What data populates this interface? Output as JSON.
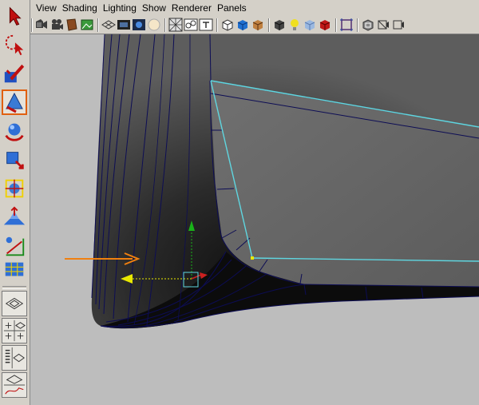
{
  "menu": {
    "items": [
      "View",
      "Shading",
      "Lighting",
      "Show",
      "Renderer",
      "Panels"
    ]
  },
  "toolbox": {
    "tools": [
      {
        "name": "select-tool-icon"
      },
      {
        "name": "lasso-tool-icon"
      },
      {
        "name": "paint-selection-tool-icon"
      },
      {
        "name": "move-tool-icon",
        "active": true
      },
      {
        "name": "rotate-tool-icon"
      },
      {
        "name": "scale-tool-icon"
      },
      {
        "name": "universal-manipulator-icon"
      },
      {
        "name": "soft-modification-tool-icon"
      },
      {
        "name": "show-manipulator-icon"
      },
      {
        "name": "last-tool-used-icon"
      }
    ],
    "layouts": [
      {
        "name": "single-pane-layout-icon"
      },
      {
        "name": "four-pane-layout-icon"
      },
      {
        "name": "outliner-persp-layout-icon"
      },
      {
        "name": "graph-persp-layout-icon"
      }
    ]
  },
  "panel_toolbar": {
    "icons": [
      "select-camera-icon",
      "camera-attributes-icon",
      "bookmarks-icon",
      "image-plane-icon",
      "grid-toggle-icon",
      "film-gate-icon",
      "resolution-gate-icon",
      "safe-action-icon",
      "field-chart-icon",
      "xray-icon",
      "wireframe-icon",
      "smooth-shade-icon",
      "textured-icon",
      "use-all-lights-icon",
      "shadows-icon",
      "isolate-select-icon",
      "high-quality-icon",
      "shade-selected-icon",
      "resolution-gate-2-icon",
      "safe-title-icon"
    ]
  },
  "colors": {
    "viewport_bg": "#bdbdbd",
    "selected_edge": "#5fd6e0",
    "wire_edge": "#0d0d55",
    "annotation_arrow": "#f08010",
    "axis_x": "#cc2020",
    "axis_y": "#19b319",
    "axis_z": "#e8e800"
  }
}
